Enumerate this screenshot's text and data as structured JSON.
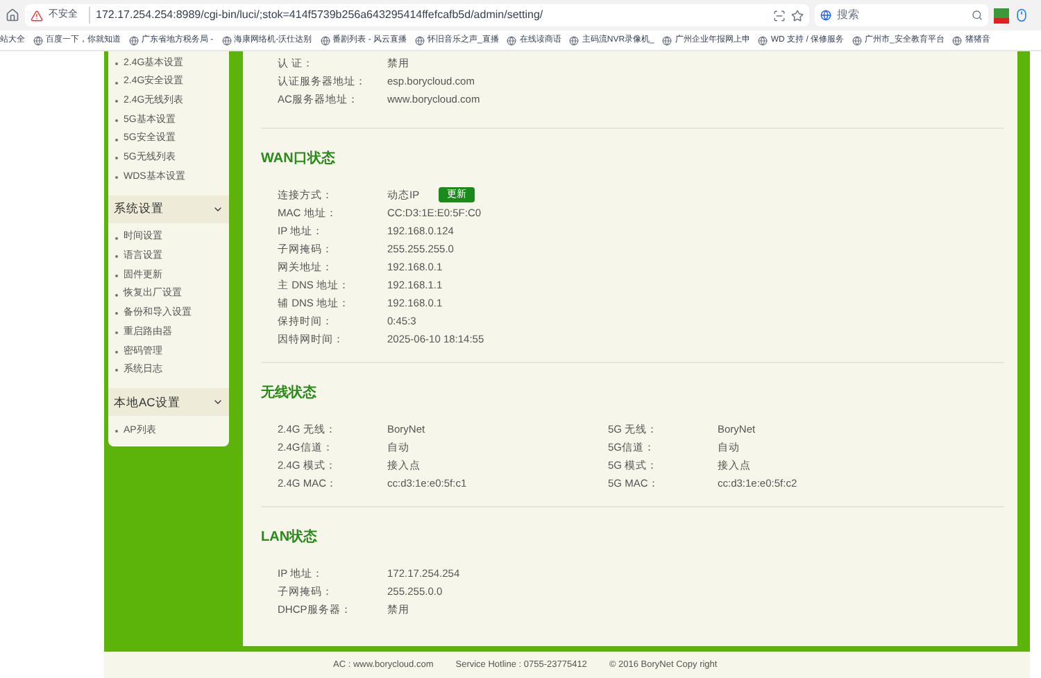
{
  "browser": {
    "address": {
      "security_label": "不安全",
      "url": "172.17.254.254:8989/cgi-bin/luci/;stok=414f5739b256a643295414ffefcafb5d/admin/setting/"
    },
    "search": {
      "placeholder": "搜索"
    },
    "bookmarks": [
      "站大全",
      "百度一下，你就知道",
      "广东省地方税务局 -",
      "海康网络机-沃仕达别",
      "番剧列表 - 风云直播",
      "怀旧音乐之声_直播",
      "在线读商语",
      "主码流NVR录像机_",
      "广州企业年报网上申",
      "WD 支持 / 保修服务",
      "广州市_安全教育平台",
      "猪猪音"
    ]
  },
  "sidebar": {
    "groups": [
      {
        "items": [
          "2.4G基本设置",
          "2.4G安全设置",
          "2.4G无线列表",
          "5G基本设置",
          "5G安全设置",
          "5G无线列表",
          "WDS基本设置"
        ]
      },
      {
        "title": "系统设置",
        "expanded": true,
        "items": [
          "时间设置",
          "语言设置",
          "固件更新",
          "恢复出厂设置",
          "备份和导入设置",
          "重启路由器",
          "密码管理",
          "系统日志"
        ]
      },
      {
        "title": "本地AC设置",
        "expanded": true,
        "items": [
          "AP列表"
        ]
      }
    ]
  },
  "sections": [
    {
      "columns": [
        [
          {
            "label": "认 证：",
            "value": "禁用"
          },
          {
            "label": "认证服务器地址：",
            "value": "esp.borycloud.com"
          },
          {
            "label": "AC服务器地址：",
            "value": "www.borycloud.com"
          }
        ]
      ]
    },
    {
      "title": "WAN口状态",
      "columns": [
        [
          {
            "label": "连接方式：",
            "value": "动态IP",
            "button": "更新"
          },
          {
            "label": "MAC 地址：",
            "value": "CC:D3:1E:E0:5F:C0"
          },
          {
            "label": "IP 地址：",
            "value": "192.168.0.124"
          },
          {
            "label": "子网掩码：",
            "value": "255.255.255.0"
          },
          {
            "label": "网关地址：",
            "value": "192.168.0.1"
          },
          {
            "label": "主 DNS 地址：",
            "value": "192.168.1.1"
          },
          {
            "label": "辅 DNS 地址：",
            "value": "192.168.0.1"
          },
          {
            "label": "保持时间：",
            "value": "0:45:3"
          },
          {
            "label": "因特网时间：",
            "value": "2025-06-10 18:14:55"
          }
        ]
      ]
    },
    {
      "title": "无线状态",
      "columns": [
        [
          {
            "label": "2.4G 无线：",
            "value": "BoryNet"
          },
          {
            "label": "2.4G信道：",
            "value": "自动"
          },
          {
            "label": "2.4G 模式：",
            "value": "接入点"
          },
          {
            "label": "2.4G MAC：",
            "value": "cc:d3:1e:e0:5f:c1"
          }
        ],
        [
          {
            "label": "5G 无线：",
            "value": "BoryNet"
          },
          {
            "label": "5G信道：",
            "value": "自动"
          },
          {
            "label": "5G 模式：",
            "value": "接入点"
          },
          {
            "label": "5G MAC：",
            "value": "cc:d3:1e:e0:5f:c2"
          }
        ]
      ]
    },
    {
      "title": "LAN状态",
      "columns": [
        [
          {
            "label": "IP 地址：",
            "value": "172.17.254.254"
          },
          {
            "label": "子网掩码：",
            "value": "255.255.0.0"
          },
          {
            "label": "DHCP服务器：",
            "value": "禁用"
          }
        ]
      ]
    }
  ],
  "footer": [
    "AC : www.borycloud.com",
    "Service Hotline : 0755-23775412",
    "© 2016 BoryNet Copy right"
  ]
}
